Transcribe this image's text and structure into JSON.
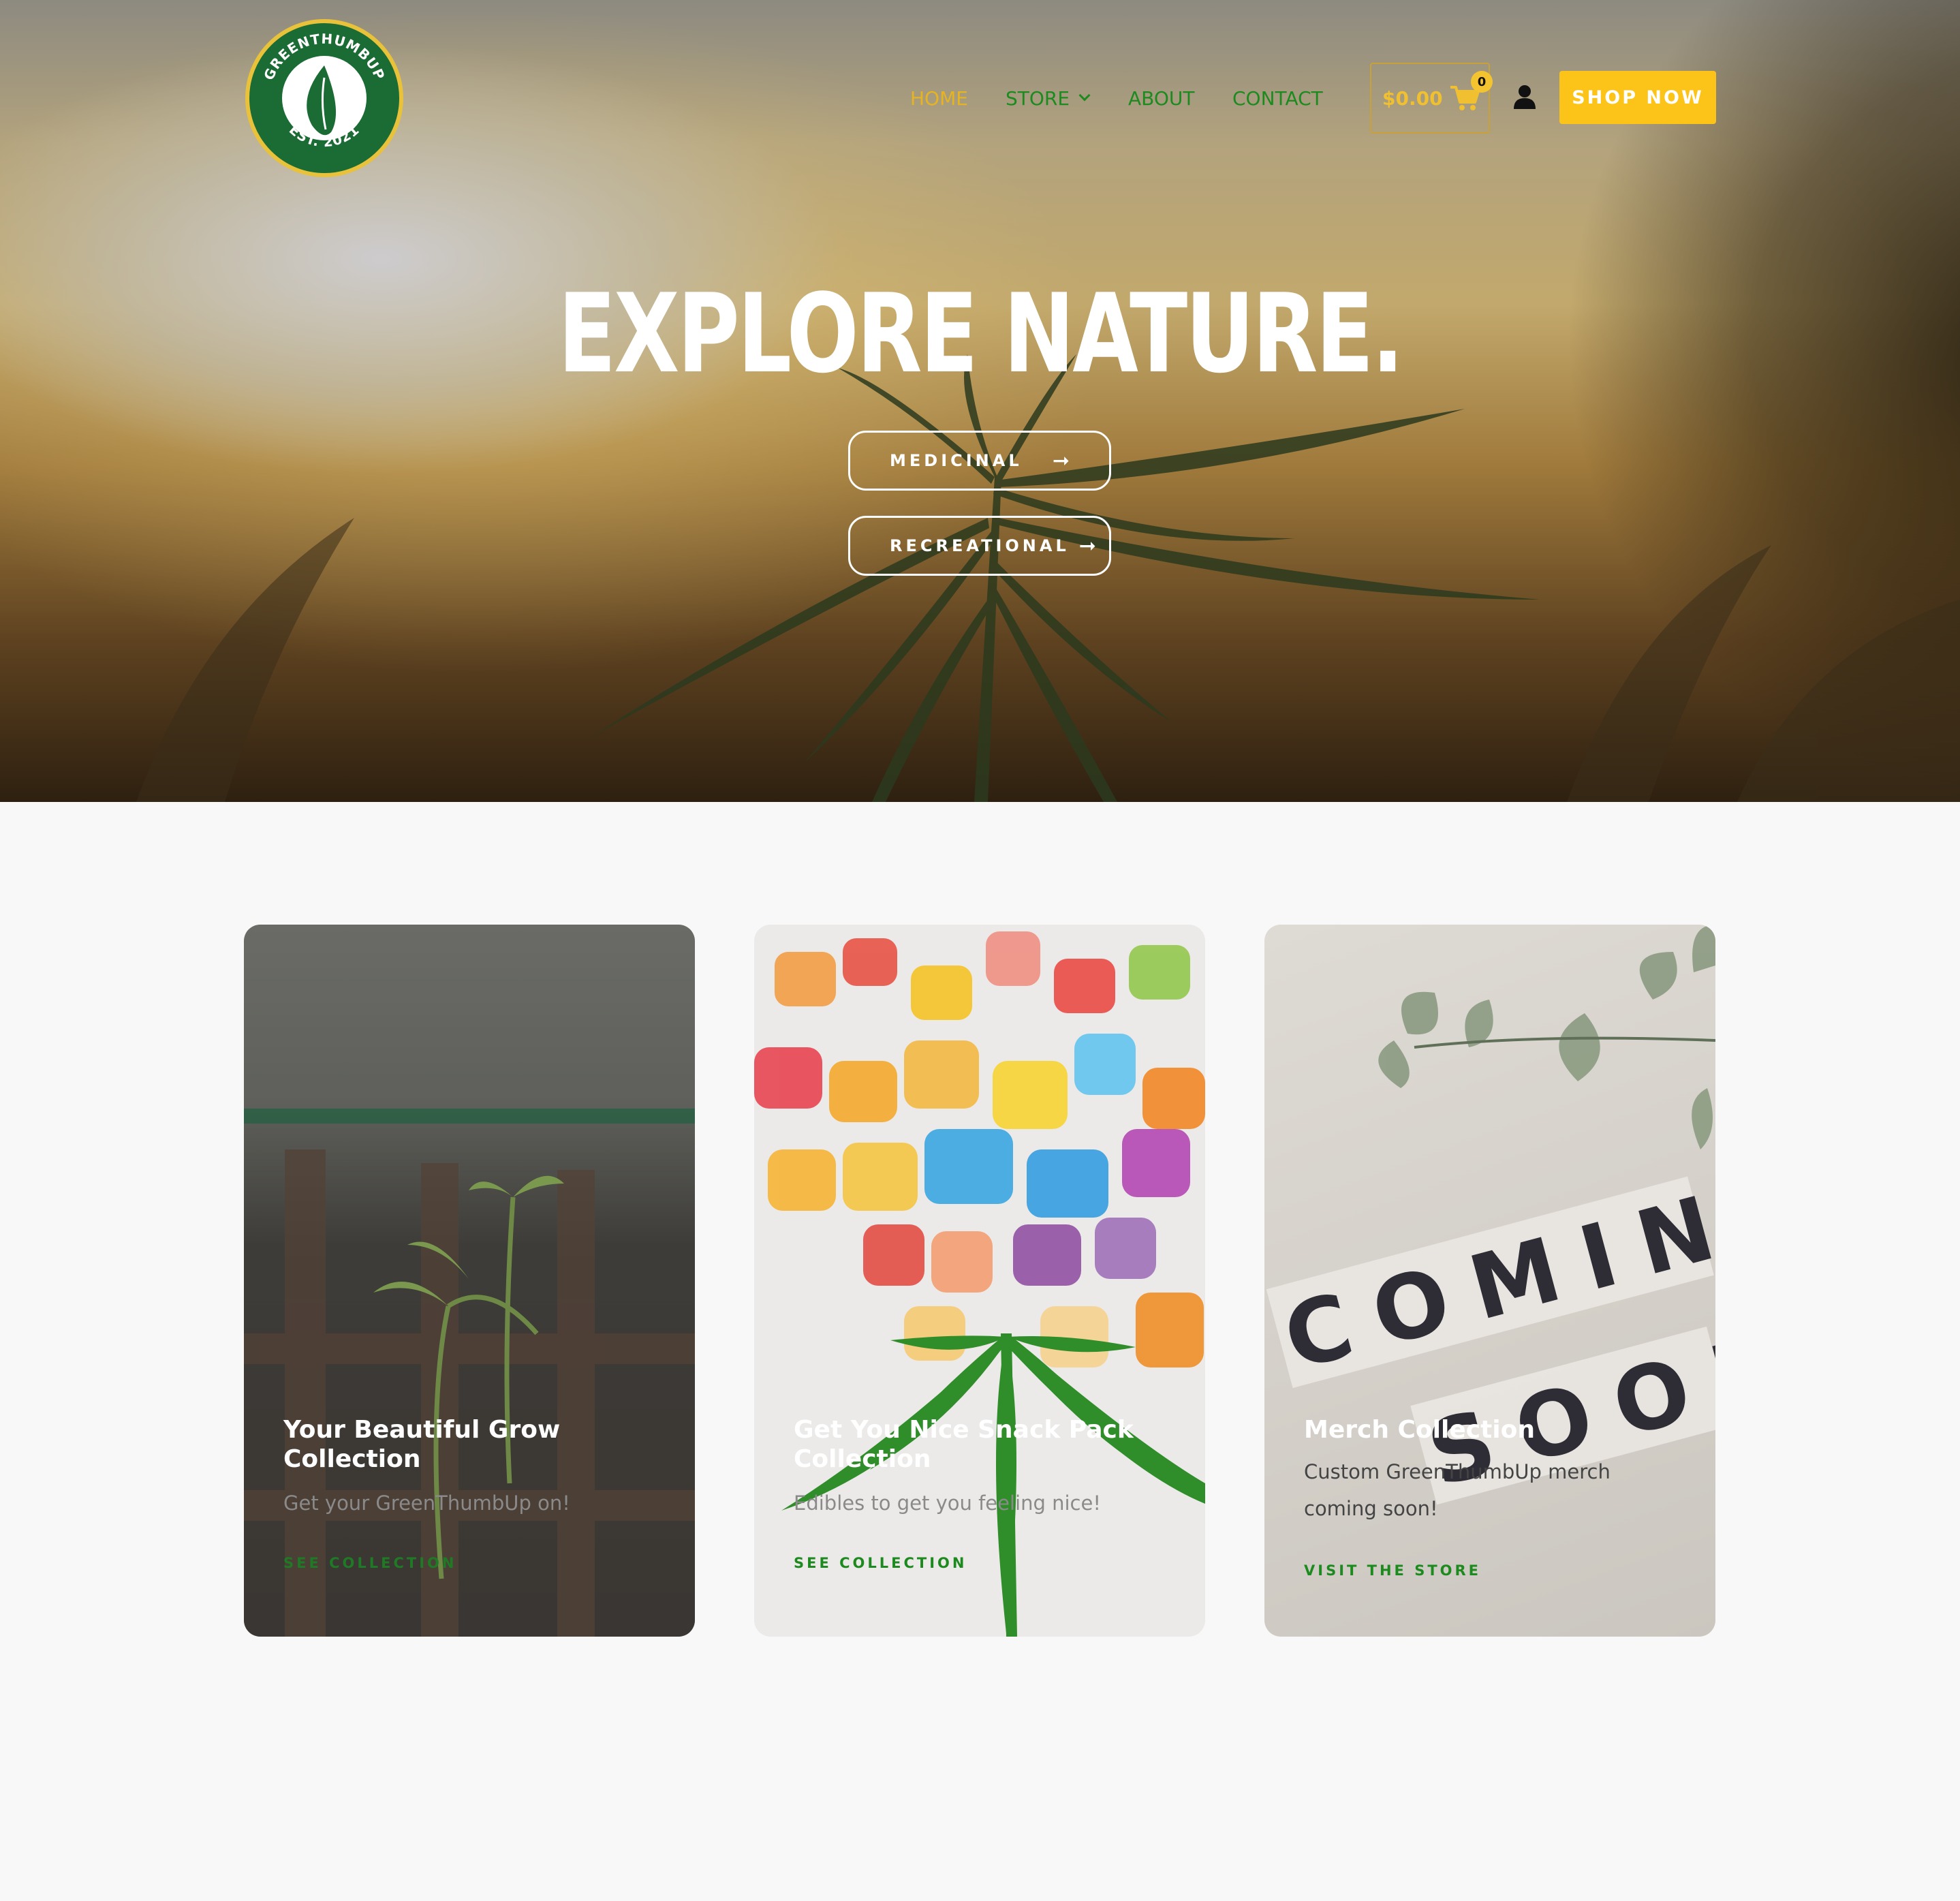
{
  "brand": {
    "logo_top_text": "GREENTHUMBUP",
    "logo_bottom_text": "EST. 2021",
    "colors": {
      "green": "#1a6b34",
      "gold": "#e8c23a",
      "accent": "#fcc419",
      "nav_green": "#1d8a1f"
    }
  },
  "nav": {
    "home": "HOME",
    "store": "STORE",
    "about": "ABOUT",
    "contact": "CONTACT"
  },
  "cart": {
    "total": "$0.00",
    "count": "0",
    "icon": "cart-icon"
  },
  "account": {
    "icon": "user-icon"
  },
  "header_cta": "SHOP NOW",
  "hero": {
    "title": "EXPLORE NATURE.",
    "buttons": [
      {
        "label": "MEDICINAL",
        "arrow": "➞"
      },
      {
        "label": "RECREATIONAL",
        "arrow": "➞"
      }
    ]
  },
  "cards": [
    {
      "title": "Your Beautiful Grow Collection",
      "description": "Get your GreenThumbUp on!",
      "link": "SEE COLLECTION"
    },
    {
      "title": "Get You Nice Snack Pack Collection",
      "description": "Edibles to get you feeling nice!",
      "link": "SEE COLLECTION"
    },
    {
      "title": "Merch Collection",
      "description": "Custom GreenThumbUp merch coming soon!",
      "link": "VISIT THE STORE",
      "image_text": [
        "COMING",
        "SOON"
      ]
    }
  ]
}
